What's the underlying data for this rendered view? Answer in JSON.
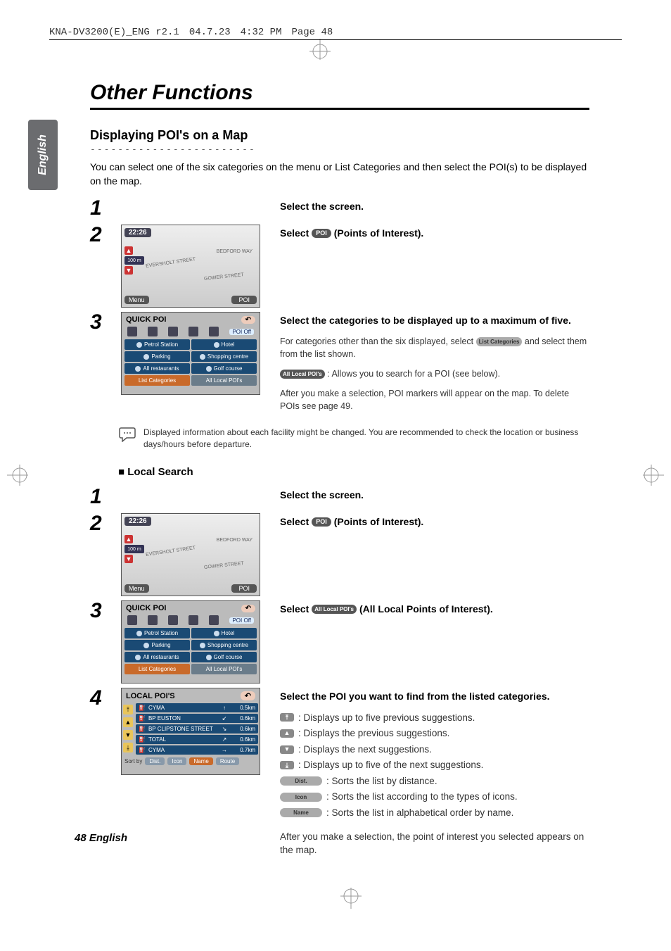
{
  "doc_header": {
    "file": "KNA-DV3200(E)_ENG r2.1",
    "date": "04.7.23",
    "time": "4:32 PM",
    "page": "Page 48"
  },
  "side_tab": "English",
  "title": "Other Functions",
  "section": {
    "heading": "Displaying POI's on a Map",
    "intro": "You can select one of the six categories on the menu or List Categories and then select the POI(s) to be displayed on the map."
  },
  "steps_a": {
    "s1": {
      "num": "1",
      "title": "Select the screen."
    },
    "s2": {
      "num": "2",
      "title_pre": "Select",
      "badge": "POI",
      "title_post": "(Points of Interest)."
    },
    "s3": {
      "num": "3",
      "title": "Select the categories to be displayed up to a maximum of five.",
      "body1_pre": "For categories other than the six displayed, select",
      "body1_badge": "List Categories",
      "body1_post": "and select them from the list shown.",
      "body2_badge": "All Local POI's",
      "body2_text": ": Allows you to search for a POI (see below).",
      "body3": "After you make a selection, POI markers will appear on the map. To delete POIs see page 49."
    }
  },
  "note": "Displayed information about each facility might be changed. You are recommended to check the location or business days/hours before departure.",
  "local_heading": "■ Local Search",
  "steps_b": {
    "s1": {
      "num": "1",
      "title": "Select the screen."
    },
    "s2": {
      "num": "2",
      "title_pre": "Select",
      "badge": "POI",
      "title_post": "(Points of Interest)."
    },
    "s3": {
      "num": "3",
      "title_pre": "Select",
      "badge": "All Local POI's",
      "title_post": "(All Local Points of Interest)."
    },
    "s4": {
      "num": "4",
      "title": "Select the POI you want to find from the listed categories.",
      "legend": [
        ": Displays up to five previous suggestions.",
        ": Displays the previous suggestions.",
        ": Displays the next suggestions.",
        ": Displays up to five of the next suggestions.",
        ": Sorts the list by distance.",
        ": Sorts the list according to the types of icons.",
        ": Sorts the list in alphabetical order by name."
      ],
      "legend_icons": [
        "⤒",
        "▲",
        "▼",
        "⤓"
      ],
      "legend_pills": [
        "Dist.",
        "Icon",
        "Name"
      ],
      "after": "After you make a selection, the point of interest you selected appears on the map."
    }
  },
  "figures": {
    "map": {
      "time": "22:26",
      "streets": [
        "EVERSHOLT STREET",
        "BEDFORD WAY",
        "GOWER STREET"
      ],
      "menu": "Menu",
      "poi": "POI",
      "scale": "100 m",
      "zoom_up": "▲",
      "zoom_dn": "▼"
    },
    "quick_poi": {
      "title": "QUICK POI",
      "poi_off": "POI Off",
      "cells": [
        "Petrol Station",
        "Hotel",
        "Parking",
        "Shopping centre",
        "All restaurants",
        "Golf course",
        "List Categories",
        "All Local POI's"
      ]
    },
    "local_list": {
      "title": "LOCAL POI'S",
      "rows": [
        {
          "name": "CYMA",
          "dir": "↑",
          "dist": "0.5km"
        },
        {
          "name": "BP EUSTON",
          "dir": "↙",
          "dist": "0.6km"
        },
        {
          "name": "BP CLIPSTONE STREET",
          "dir": "↘",
          "dist": "0.6km"
        },
        {
          "name": "TOTAL",
          "dir": "↗",
          "dist": "0.6km"
        },
        {
          "name": "CYMA",
          "dir": "→",
          "dist": "0.7km"
        }
      ],
      "sort_label": "Sort by",
      "sort_buttons": [
        "Dist.",
        "Icon",
        "Name",
        "Route"
      ],
      "arrows": [
        "⤒",
        "▲",
        "▼",
        "⤓"
      ]
    }
  },
  "footer": "48 English"
}
